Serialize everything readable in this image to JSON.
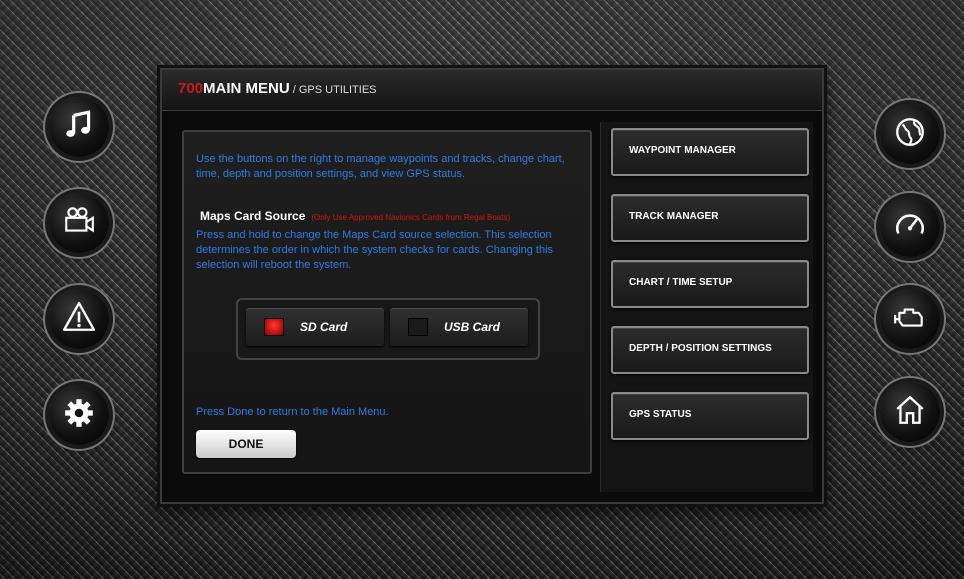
{
  "header": {
    "model": "700",
    "title": "MAIN MENU",
    "separator": " / ",
    "subtitle": "GPS UTILITIES"
  },
  "left_buttons": [
    {
      "icon": "music-note-icon"
    },
    {
      "icon": "video-camera-icon"
    },
    {
      "icon": "warning-icon"
    },
    {
      "icon": "gear-icon"
    }
  ],
  "right_buttons": [
    {
      "icon": "globe-icon"
    },
    {
      "icon": "speedometer-icon"
    },
    {
      "icon": "engine-icon"
    },
    {
      "icon": "home-icon"
    }
  ],
  "main": {
    "intro": "Use the buttons on the right to manage waypoints and tracks, change chart, time, depth and position settings, and  view GPS status.",
    "maps_card_title": "Maps Card Source",
    "maps_card_note": "(Only Use Approved Navionics Cards from Regal Boats)",
    "maps_card_desc": "Press and hold to change the Maps Card source selection. This selection determines the order in which the system checks for cards. Changing this selection will reboot the system.",
    "sd_card_label": "SD Card",
    "usb_card_label": "USB Card",
    "selected_card": "SD Card",
    "done_prompt": "Press Done to return to the Main Menu.",
    "done_label": "DONE"
  },
  "menu": {
    "items": [
      {
        "label": "WAYPOINT MANAGER"
      },
      {
        "label": "TRACK MANAGER"
      },
      {
        "label": "CHART / TIME SETUP"
      },
      {
        "label": "DEPTH / POSITION SETTINGS"
      },
      {
        "label": "GPS STATUS"
      }
    ]
  },
  "colors": {
    "accent_red": "#c8171c",
    "text_blue": "#2e7be0",
    "indicator_on": "#e02020"
  }
}
